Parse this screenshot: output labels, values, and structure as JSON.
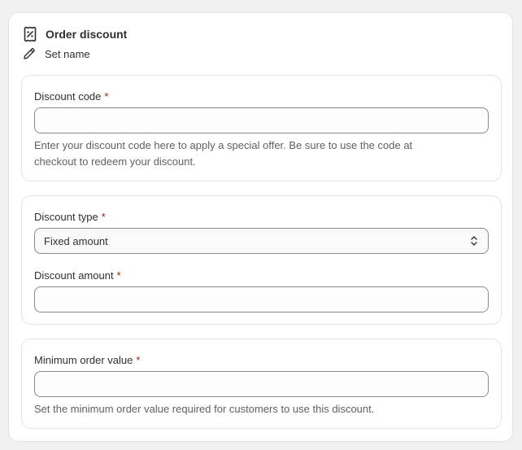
{
  "header": {
    "title": "Order discount",
    "icon": "discount-receipt-icon",
    "set_name_label": "Set name",
    "set_name_icon": "pencil-icon"
  },
  "code_section": {
    "label": "Discount code",
    "required_mark": "*",
    "value": "",
    "help_text": "Enter your discount code here to apply a special offer. Be sure to use the code at checkout to redeem your discount."
  },
  "type_section": {
    "type_label": "Discount type",
    "required_mark": "*",
    "selected_type": "Fixed amount",
    "amount_label": "Discount amount",
    "amount_value": ""
  },
  "minimum_section": {
    "label": "Minimum order value",
    "required_mark": "*",
    "value": "",
    "help_text": "Set the minimum order value required for customers to use this discount."
  },
  "colors": {
    "required": "#8e1f0b",
    "border": "#8a8a8a",
    "card_border": "#e3e3e3",
    "help_text": "#616161"
  }
}
